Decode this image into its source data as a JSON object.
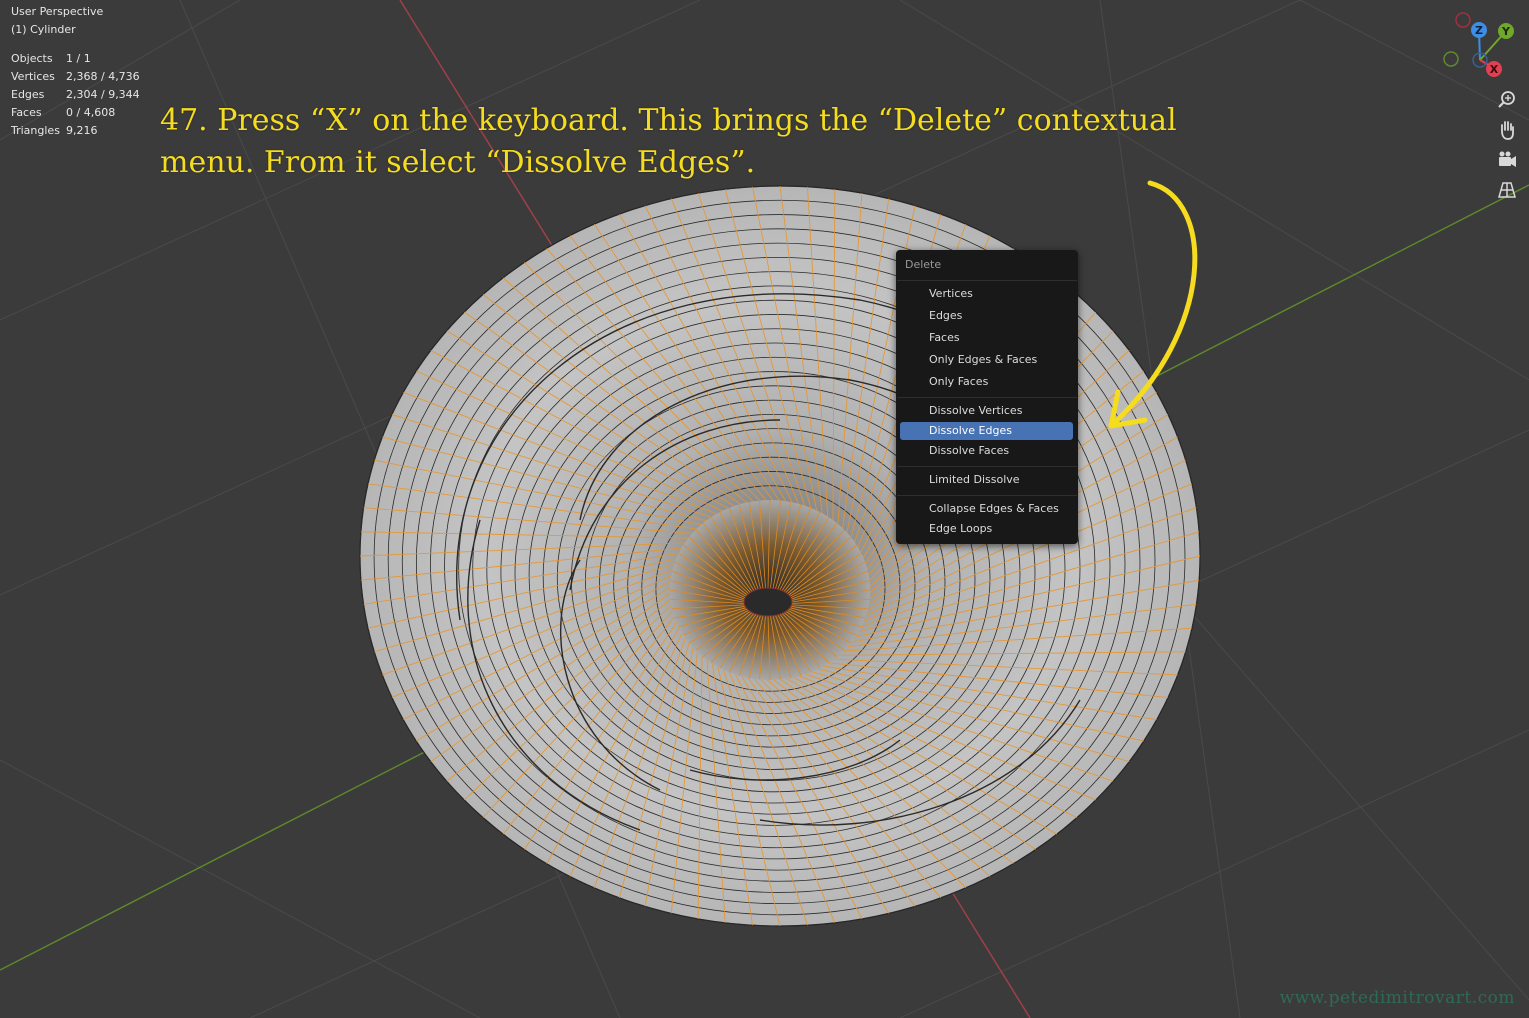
{
  "viewport": {
    "title": "User Perspective",
    "object_label": "(1) Cylinder"
  },
  "stats": [
    {
      "label": "Objects",
      "value": "1 / 1"
    },
    {
      "label": "Vertices",
      "value": "2,368 / 4,736"
    },
    {
      "label": "Edges",
      "value": "2,304 / 9,344"
    },
    {
      "label": "Faces",
      "value": "0 / 4,608"
    },
    {
      "label": "Triangles",
      "value": "9,216"
    }
  ],
  "tutorial": {
    "line1": "47. Press “X” on the keyboard. This brings the “Delete” contextual",
    "line2": "menu. From it select “Dissolve Edges”."
  },
  "delete_menu": {
    "title": "Delete",
    "items": [
      {
        "label": "Vertices"
      },
      {
        "label": "Edges"
      },
      {
        "label": "Faces"
      },
      {
        "label": "Only Edges & Faces"
      },
      {
        "label": "Only Faces"
      },
      {
        "label": "Dissolve Vertices"
      },
      {
        "label": "Dissolve Edges",
        "highlighted": true
      },
      {
        "label": "Dissolve Faces"
      },
      {
        "label": "Limited Dissolve"
      },
      {
        "label": "Collapse Edges & Faces"
      },
      {
        "label": "Edge Loops"
      }
    ]
  },
  "axis_gizmo": {
    "x_label": "X",
    "y_label": "Y",
    "z_label": "Z"
  },
  "nav_buttons": [
    "zoom-icon",
    "hand-pan-icon",
    "camera-icon",
    "grid-perspective-icon"
  ],
  "colors": {
    "accent": "#4772b3",
    "annotation": "#f5dc1e",
    "selected_edge": "#f0a030",
    "x_axis": "#e04050",
    "y_axis": "#6fa82a",
    "z_axis": "#3e8ee6"
  },
  "watermark": "www.petedimitrovart.com"
}
